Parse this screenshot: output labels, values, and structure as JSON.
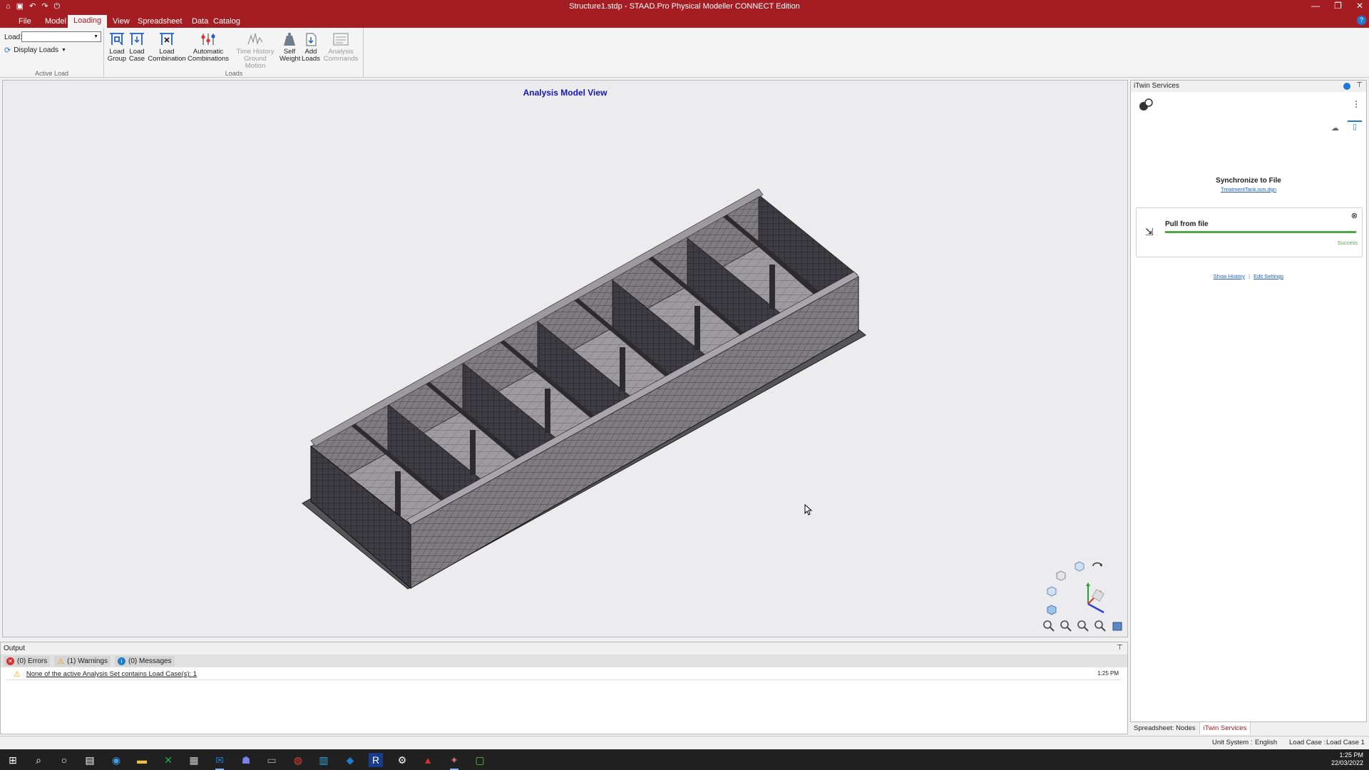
{
  "window": {
    "title": "Structure1.stdp - STAAD.Pro Physical Modeller CONNECT Edition",
    "controls": [
      "—",
      "❐",
      "✕"
    ]
  },
  "menu": {
    "tabs": [
      "File",
      "Model",
      "Loading",
      "View",
      "Spreadsheet",
      "Data",
      "Catalog"
    ],
    "active": "Loading"
  },
  "ribbon": {
    "load_label": "Load:",
    "display_loads": "Display Loads",
    "active_load_group": "Active Load",
    "loads_group": "Loads",
    "buttons": [
      {
        "line1": "Load",
        "line2": "Group",
        "icon": "load-group-icon"
      },
      {
        "line1": "Load",
        "line2": "Case",
        "icon": "load-case-icon"
      },
      {
        "line1": "Load",
        "line2": "Combination",
        "icon": "load-combination-icon"
      },
      {
        "line1": "Automatic",
        "line2": "Combinations",
        "icon": "automatic-combinations-icon"
      },
      {
        "line1": "Time History",
        "line2": "Ground Motion",
        "icon": "time-history-icon"
      },
      {
        "line1": "Self",
        "line2": "Weight",
        "icon": "self-weight-icon"
      },
      {
        "line1": "Add",
        "line2": "Loads",
        "icon": "add-loads-icon"
      },
      {
        "line1": "Analysis",
        "line2": "Commands",
        "icon": "analysis-commands-icon"
      }
    ]
  },
  "viewport": {
    "title": "Analysis Model View"
  },
  "output": {
    "title": "Output",
    "errors": "(0) Errors",
    "warnings": "(1) Warnings",
    "messages": "(0) Messages",
    "rows": [
      {
        "text": "None of the active Analysis Set contains Load Case(s): 1",
        "time": "1:25 PM"
      }
    ]
  },
  "itwin": {
    "title": "iTwin Services",
    "sync_title": "Synchronize to File",
    "sync_file": "TreatmentTank.ism.dgn",
    "pull_title": "Pull from file",
    "pull_status": "Success",
    "pull_progress": 1.0,
    "show_history": "Show History",
    "separator": "|",
    "edit_settings": "Edit Settings"
  },
  "panel_tabs": [
    "Spreadsheet: Nodes",
    "iTwin Services"
  ],
  "statusbar": {
    "unit_label": "Unit System :",
    "unit_value": "English",
    "loadcase_label": "Load Case :",
    "loadcase_value": "Load Case 1"
  },
  "taskbar": {
    "time": "1:25 PM",
    "date": "22/03/2022"
  },
  "colors": {
    "brand": "#a31d23",
    "view_title": "#1414b8",
    "success": "#50a74a",
    "link": "#1f5fc5"
  }
}
